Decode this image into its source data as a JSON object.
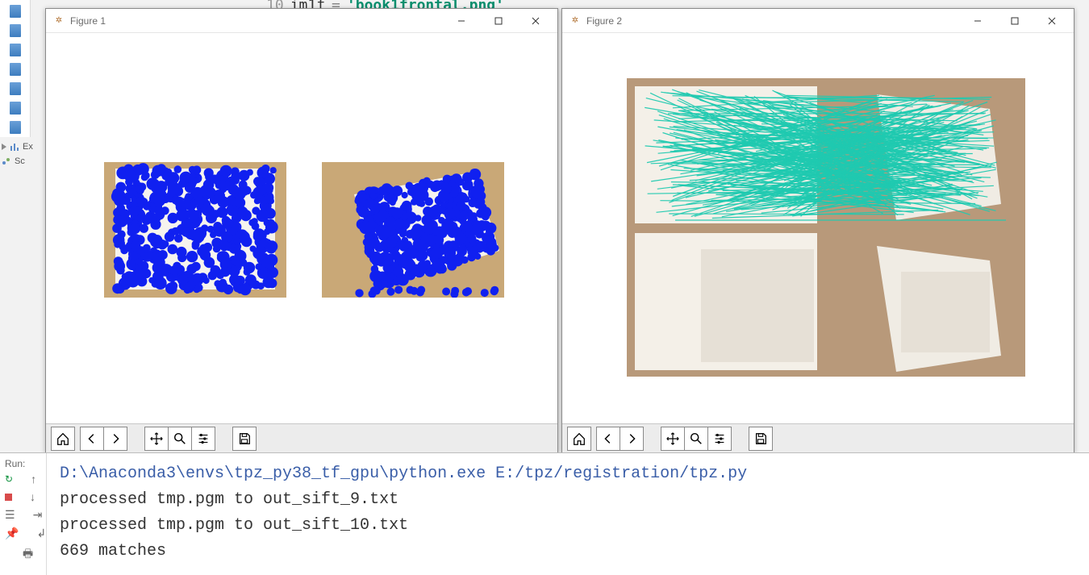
{
  "editor": {
    "line_number": "10",
    "var": "im1f",
    "eq": "=",
    "str": "'book1frontal.png'"
  },
  "figure1": {
    "title": "Figure 1"
  },
  "figure2": {
    "title": "Figure 2"
  },
  "left_sidebar": {
    "label_ex": "Ex",
    "label_sc": "Sc"
  },
  "toolbar": {
    "home": "Home",
    "back": "Back",
    "forward": "Forward",
    "pan": "Pan",
    "zoom": "Zoom",
    "config": "Configure subplots",
    "save": "Save"
  },
  "run": {
    "label": "Run:",
    "lines": [
      "D:\\Anaconda3\\envs\\tpz_py38_tf_gpu\\python.exe E:/tpz/registration/tpz.py",
      "processed tmp.pgm to out_sift_9.txt",
      "processed tmp.pgm to out_sift_10.txt",
      "669 matches"
    ]
  }
}
